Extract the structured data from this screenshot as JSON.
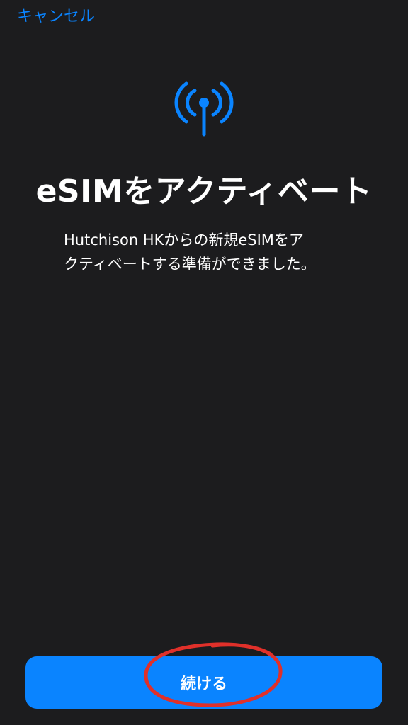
{
  "nav": {
    "cancel_label": "キャンセル"
  },
  "header": {
    "icon": "antenna-radiowaves-icon",
    "title": "eSIMをアクティベート",
    "subtitle_line1": "Hutchison HKからの新規eSIMをア",
    "subtitle_line2": "クティベートする準備ができました。"
  },
  "footer": {
    "continue_label": "続ける"
  },
  "colors": {
    "background": "#1c1c1e",
    "accent": "#0a84ff",
    "annotation": "#e0302a"
  }
}
